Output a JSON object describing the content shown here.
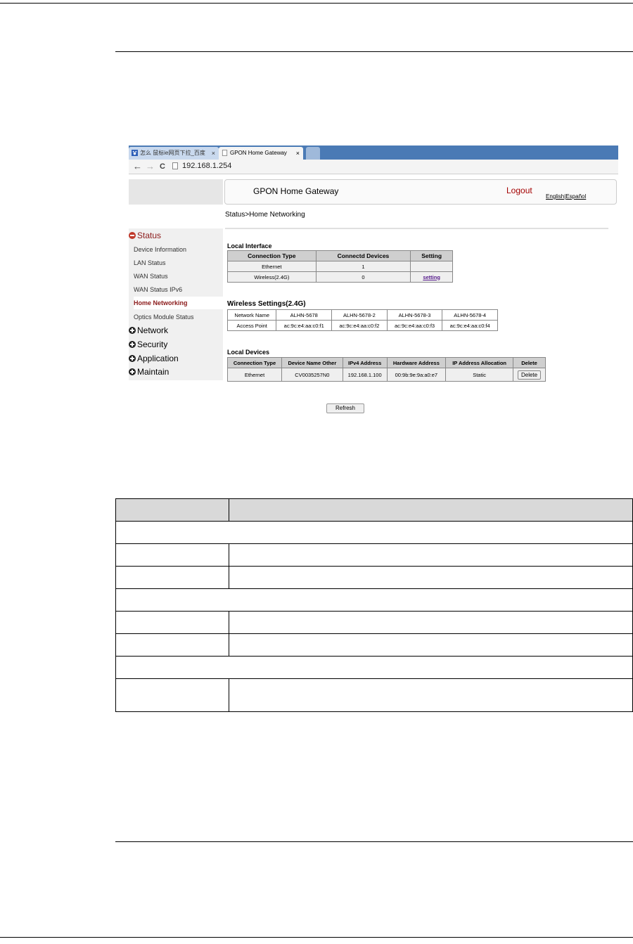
{
  "browser": {
    "tabs": [
      {
        "label": "怎么 鼠标ie网页下拉_百度"
      },
      {
        "label": "GPON Home Gateway"
      }
    ],
    "tab_close": "×",
    "nav": {
      "back": "←",
      "forward": "→",
      "reload": "C"
    },
    "address": "192.168.1.254"
  },
  "header": {
    "title": "GPON Home Gateway",
    "logout": "Logout",
    "lang_english": "English",
    "lang_sep": "|",
    "lang_espanol": "Español"
  },
  "breadcrumb": "Status>Home Networking",
  "sidebar": {
    "status": "Status",
    "status_items": [
      "Device Information",
      "LAN Status",
      "WAN Status",
      "WAN Status IPv6",
      "Home Networking",
      "Optics Module Status"
    ],
    "categories": [
      "Network",
      "Security",
      "Application",
      "Maintain"
    ]
  },
  "local_interface": {
    "title": "Local Interface",
    "headers": [
      "Connection Type",
      "Connectd Devices",
      "Setting"
    ],
    "rows": [
      [
        "Ethernet",
        "1",
        ""
      ],
      [
        "Wireless(2.4G)",
        "0",
        "setting"
      ]
    ]
  },
  "wireless_settings": {
    "title": "Wireless Settings(2.4G)",
    "rows": [
      [
        "Network Name",
        "ALHN-5678",
        "ALHN-5678-2",
        "ALHN-5678-3",
        "ALHN-5678-4"
      ],
      [
        "Access Point",
        "ac:9c:e4:aa:c0:f1",
        "ac:9c:e4:aa:c0:f2",
        "ac:9c:e4:aa:c0:f3",
        "ac:9c:e4:aa:c0:f4"
      ]
    ]
  },
  "local_devices": {
    "title": "Local Devices",
    "headers": [
      "Connection Type",
      "Device Name Other",
      "IPv4 Address",
      "Hardware Address",
      "IP Address Allocation",
      "Delete"
    ],
    "rows": [
      [
        "Ethernet",
        "CV0035257N0",
        "192.168.1.100",
        "00:9b:9e:9a:a0:e7",
        "Static",
        "Delete"
      ]
    ]
  },
  "refresh_label": "Refresh"
}
